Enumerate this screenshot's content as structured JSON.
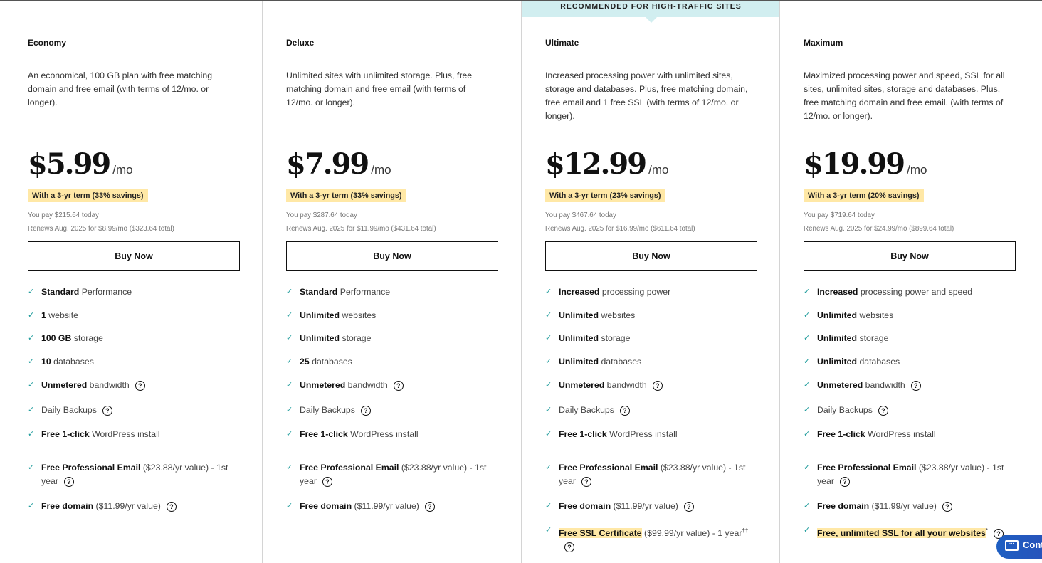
{
  "ribbon": "RECOMMENDED FOR HIGH-TRAFFIC SITES",
  "plans": [
    {
      "name": "Economy",
      "desc": "An economical, 100 GB plan with free matching domain and free email (with terms of 12/mo. or longer).",
      "price": "$5.99",
      "per": "/mo",
      "term": "With a 3-yr term (33% savings)",
      "pay": "You pay $215.64 today",
      "renew": "Renews Aug. 2025 for $8.99/mo ($323.64 total)",
      "buy": "Buy Now",
      "features": [
        {
          "bold": "Standard",
          "rest": " Performance"
        },
        {
          "bold": "1",
          "rest": " website"
        },
        {
          "bold": "100 GB",
          "rest": " storage"
        },
        {
          "bold": "10",
          "rest": " databases"
        },
        {
          "bold": "Unmetered",
          "rest": " bandwidth",
          "help": true
        },
        {
          "bold": "",
          "rest": "Daily Backups",
          "help": true
        },
        {
          "bold": "Free 1-click",
          "rest": " WordPress install"
        }
      ],
      "extras": [
        {
          "bold": "Free Professional Email",
          "rest": " ($23.88/yr value) - 1st year",
          "help": true
        },
        {
          "bold": "Free domain",
          "rest": " ($11.99/yr value)",
          "help": true
        }
      ]
    },
    {
      "name": "Deluxe",
      "desc": "Unlimited sites with unlimited storage. Plus, free matching domain and free email (with terms of 12/mo. or longer).",
      "price": "$7.99",
      "per": "/mo",
      "term": "With a 3-yr term (33% savings)",
      "pay": "You pay $287.64 today",
      "renew": "Renews Aug. 2025 for $11.99/mo ($431.64 total)",
      "buy": "Buy Now",
      "features": [
        {
          "bold": "Standard",
          "rest": " Performance"
        },
        {
          "bold": "Unlimited",
          "rest": " websites"
        },
        {
          "bold": "Unlimited",
          "rest": " storage"
        },
        {
          "bold": "25",
          "rest": " databases"
        },
        {
          "bold": "Unmetered",
          "rest": " bandwidth",
          "help": true
        },
        {
          "bold": "",
          "rest": "Daily Backups",
          "help": true
        },
        {
          "bold": "Free 1-click",
          "rest": " WordPress install"
        }
      ],
      "extras": [
        {
          "bold": "Free Professional Email",
          "rest": " ($23.88/yr value) - 1st year",
          "help": true
        },
        {
          "bold": "Free domain",
          "rest": " ($11.99/yr value)",
          "help": true
        }
      ]
    },
    {
      "name": "Ultimate",
      "desc": "Increased processing power with unlimited sites, storage and databases. Plus, free matching domain, free email and 1 free SSL (with terms of 12/mo. or longer).",
      "price": "$12.99",
      "per": "/mo",
      "term": "With a 3-yr term (23% savings)",
      "pay": "You pay $467.64 today",
      "renew": "Renews Aug. 2025 for $16.99/mo ($611.64 total)",
      "buy": "Buy Now",
      "features": [
        {
          "bold": "Increased",
          "rest": " processing power"
        },
        {
          "bold": "Unlimited",
          "rest": " websites"
        },
        {
          "bold": "Unlimited",
          "rest": " storage"
        },
        {
          "bold": "Unlimited",
          "rest": " databases"
        },
        {
          "bold": "Unmetered",
          "rest": " bandwidth",
          "help": true
        },
        {
          "bold": "",
          "rest": "Daily Backups",
          "help": true
        },
        {
          "bold": "Free 1-click",
          "rest": " WordPress install"
        }
      ],
      "extras": [
        {
          "bold": "Free Professional Email",
          "rest": " ($23.88/yr value) - 1st year",
          "help": true
        },
        {
          "bold": "Free domain",
          "rest": " ($11.99/yr value)",
          "help": true
        },
        {
          "highlight": "Free SSL Certificate",
          "rest": " ($99.99/yr value) - 1 year",
          "sup": "††",
          "help": true
        }
      ]
    },
    {
      "name": "Maximum",
      "desc": "Maximized processing power and speed, SSL for all sites, unlimited sites, storage and databases. Plus, free matching domain and free email. (with terms of 12/mo. or longer).",
      "price": "$19.99",
      "per": "/mo",
      "term": "With a 3-yr term (20% savings)",
      "pay": "You pay $719.64 today",
      "renew": "Renews Aug. 2025 for $24.99/mo ($899.64 total)",
      "buy": "Buy Now",
      "features": [
        {
          "bold": "Increased",
          "rest": " processing power and speed"
        },
        {
          "bold": "Unlimited",
          "rest": " websites"
        },
        {
          "bold": "Unlimited",
          "rest": " storage"
        },
        {
          "bold": "Unlimited",
          "rest": " databases"
        },
        {
          "bold": "Unmetered",
          "rest": " bandwidth",
          "help": true
        },
        {
          "bold": "",
          "rest": "Daily Backups",
          "help": true
        },
        {
          "bold": "Free 1-click",
          "rest": " WordPress install"
        }
      ],
      "extras": [
        {
          "bold": "Free Professional Email",
          "rest": " ($23.88/yr value) - 1st year",
          "help": true
        },
        {
          "bold": "Free domain",
          "rest": " ($11.99/yr value)",
          "help": true
        },
        {
          "highlight": "Free, unlimited SSL for all your websites",
          "sup": "*",
          "rest": "",
          "help": true
        }
      ]
    }
  ],
  "chat": {
    "label": "Contact Us",
    "visible_label": "Cont"
  },
  "colors": {
    "accent_check": "#1a9a9a",
    "highlight": "#ffe8a6",
    "ribbon": "#d1eef0",
    "chat": "#1e5fc2"
  }
}
